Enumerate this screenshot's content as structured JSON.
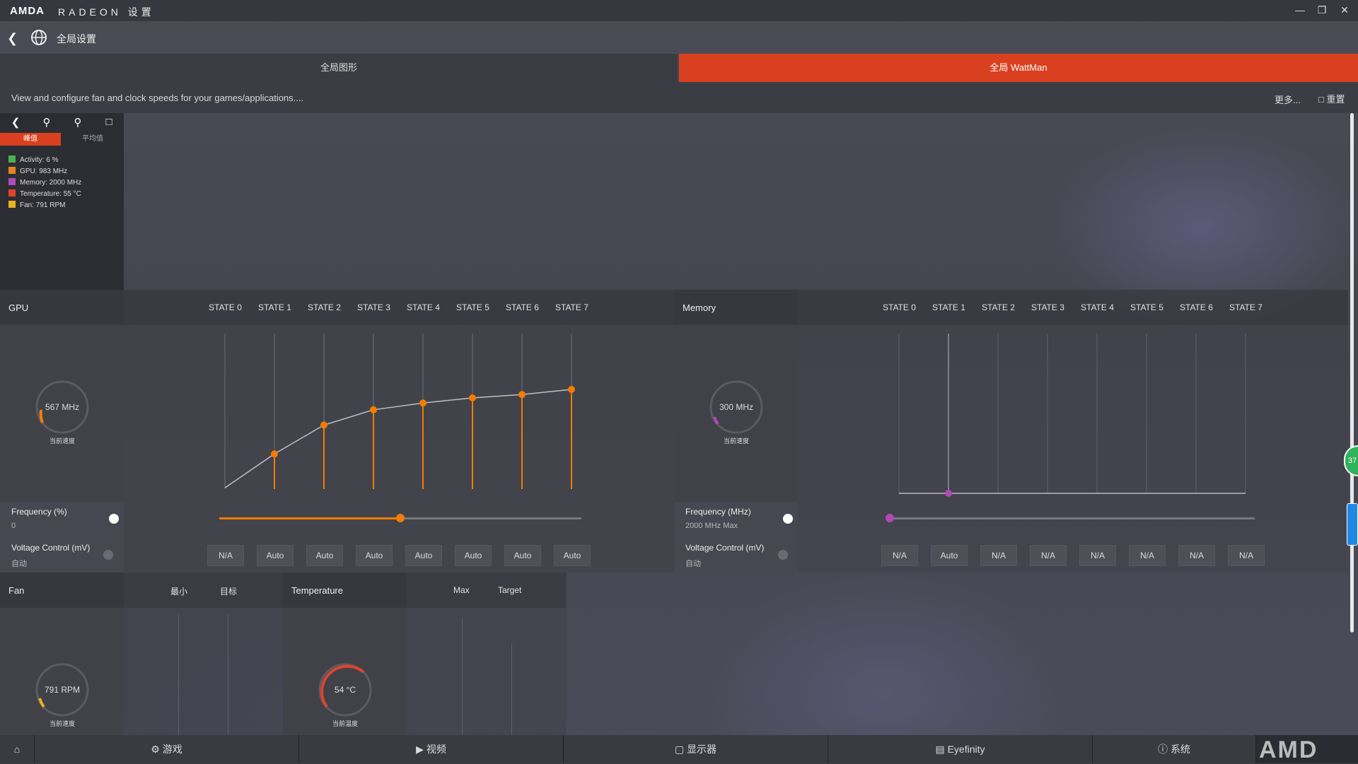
{
  "window": {
    "logo": "AMDA",
    "brand": "RADEON 设置",
    "min_icon": "minimize-icon",
    "restore_icon": "restore-icon",
    "close_icon": "close-icon"
  },
  "nav": {
    "breadcrumb": "全局设置"
  },
  "tabs": [
    {
      "label": "全局图形"
    },
    {
      "label": "全局 WattMan",
      "active": true
    }
  ],
  "infobar": {
    "description": "View and configure fan and clock speeds for your games/applications....",
    "more": "更多...",
    "reset": "重置"
  },
  "monitor": {
    "tab_peak": "峰值",
    "tab_avg": "平均值",
    "legend": [
      {
        "label": "Activity: 6 %",
        "color": "#4caf50"
      },
      {
        "label": "GPU: 983 MHz",
        "color": "#e8841f"
      },
      {
        "label": "Memory: 2000 MHz",
        "color": "#b04ab8"
      },
      {
        "label": "Temperature: 55 °C",
        "color": "#e0432b"
      },
      {
        "label": "Fan: 791 RPM",
        "color": "#e8b21f"
      }
    ]
  },
  "gpu": {
    "title": "GPU",
    "states": [
      "STATE 0",
      "STATE 1",
      "STATE 2",
      "STATE 3",
      "STATE 4",
      "STATE 5",
      "STATE 6",
      "STATE 7"
    ],
    "gauge_value": "567 MHz",
    "gauge_sub": "当前速度",
    "frequency_label": "Frequency (%)",
    "frequency_value": "0",
    "voltage_label": "Voltage Control (mV)",
    "voltage_value": "自动",
    "voltage_buttons": [
      "N/A",
      "Auto",
      "Auto",
      "Auto",
      "Auto",
      "Auto",
      "Auto",
      "Auto"
    ],
    "curve_levels": [
      0.02,
      0.22,
      0.39,
      0.48,
      0.52,
      0.55,
      0.57,
      0.6
    ],
    "slider_fraction": 0.5,
    "accent": "#f57c00"
  },
  "memory": {
    "title": "Memory",
    "states": [
      "STATE 0",
      "STATE 1",
      "STATE 2",
      "STATE 3",
      "STATE 4",
      "STATE 5",
      "STATE 6",
      "STATE 7"
    ],
    "gauge_value": "300 MHz",
    "gauge_sub": "当前速度",
    "frequency_label": "Frequency (MHz)",
    "frequency_value": "2000 MHz Max",
    "voltage_label": "Voltage Control (mV)",
    "voltage_value": "自动",
    "voltage_buttons": [
      "N/A",
      "Auto",
      "N/A",
      "N/A",
      "N/A",
      "N/A",
      "N/A",
      "N/A"
    ],
    "accent": "#b04ab8"
  },
  "fan": {
    "title": "Fan",
    "col_min": "最小",
    "col_target": "目标",
    "gauge_value": "791 RPM",
    "gauge_sub": "当前速度"
  },
  "temperature": {
    "title": "Temperature",
    "col_max": "Max",
    "col_target": "Target",
    "gauge_value": "54 °C",
    "gauge_sub": "当前温度"
  },
  "side_badge": "37",
  "taskbar": {
    "home_icon": "home-icon",
    "items": [
      {
        "label": "游戏",
        "icon": "gamepad-icon"
      },
      {
        "label": "视频",
        "icon": "play-icon"
      },
      {
        "label": "显示器",
        "icon": "monitor-icon"
      },
      {
        "label": "Eyefinity",
        "icon": "eyefinity-icon"
      },
      {
        "label": "系统",
        "icon": "info-icon"
      }
    ],
    "brand": "AMD"
  }
}
